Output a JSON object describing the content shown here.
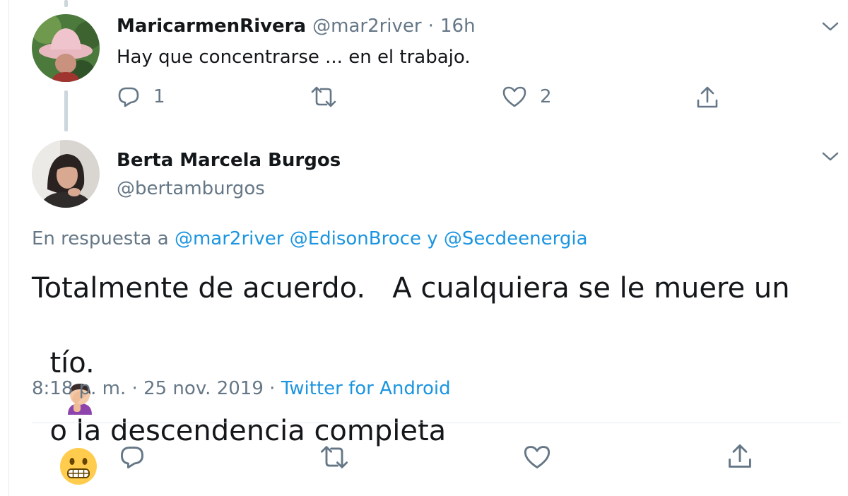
{
  "reply_tweet": {
    "name": "MaricarmenRivera",
    "handle": "@mar2river",
    "separator": "·",
    "time": "16h",
    "text": "Hay que concentrarse ... en el trabajo.",
    "reply_count": "1",
    "like_count": "2"
  },
  "main_tweet": {
    "name": "Berta Marcela Burgos",
    "handle": "@bertamburgos",
    "reply_prefix": "En respuesta a",
    "mention_1": "@mar2river",
    "mention_2": "@EdisonBroce",
    "mention_conj": "y",
    "mention_3": "@Secdeenergia",
    "line1": "Totalmente de acuerdo.   A cualquiera se le muere un",
    "line2_a": "tío.",
    "line2_b": "o la descendencia completa",
    "time": "8:18 p. m.",
    "date": "25 nov. 2019",
    "separator": "·",
    "source": "Twitter for Android"
  },
  "icons": {
    "reply": "reply-icon",
    "retweet": "retweet-icon",
    "like": "heart-icon",
    "share": "share-icon",
    "more": "chevron-down-icon",
    "emoji_1": "facepalm-emoji",
    "emoji_2": "grimacing-emoji"
  },
  "colors": {
    "link": "#1b95e0",
    "muted": "#657786",
    "text": "#14171a",
    "divider": "#e6ecf0"
  }
}
